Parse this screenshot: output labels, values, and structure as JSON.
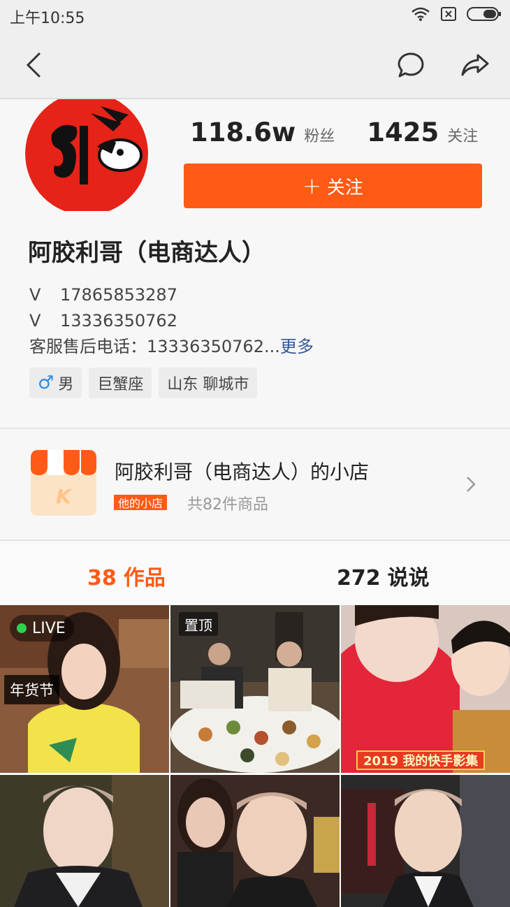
{
  "status_bar": {
    "time": "上午10:55"
  },
  "navbar": {
    "back_icon": "back-arrow-icon",
    "message_icon": "chat-bubble-icon",
    "share_icon": "share-icon"
  },
  "profile": {
    "fans_count": "118.6w",
    "fans_label": "粉丝",
    "following_count": "1425",
    "following_label": "关注",
    "follow_button_label": "关注",
    "name": "阿胶利哥（电商达人）",
    "bio_lines": [
      {
        "prefix": "V",
        "text": "17865853287"
      },
      {
        "prefix": "V",
        "text": "13336350762"
      }
    ],
    "bio_service": "客服售后电话：13336350762...",
    "bio_more": "更多",
    "tags": {
      "gender": "男",
      "zodiac": "巨蟹座",
      "location": "山东 聊城市"
    }
  },
  "shop": {
    "title": "阿胶利哥（电商达人）的小店",
    "badge": "他的小店",
    "item_count": "共82件商品"
  },
  "tabs": [
    {
      "count": "38",
      "label": "作品",
      "active": true
    },
    {
      "count": "272",
      "label": "说说",
      "active": false
    }
  ],
  "grid": {
    "live_label": "LIVE",
    "festival_label": "年货节",
    "pinned_label": "置顶",
    "album_label": "2019 我的快手影集"
  },
  "colors": {
    "accent": "#ff5a16",
    "link": "#35579a",
    "live_dot": "#31d04f"
  }
}
